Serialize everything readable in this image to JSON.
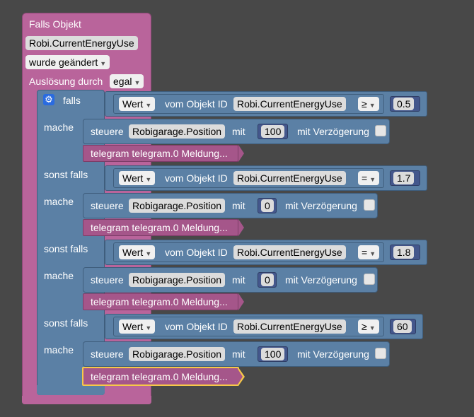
{
  "trigger": {
    "title": "Falls Objekt",
    "object_id": "Robi.CurrentEnergyUse",
    "condition": "wurde geändert",
    "trigger_label": "Auslösung durch",
    "trigger_value": "egal"
  },
  "labels": {
    "if": "falls",
    "do": "mache",
    "else_if": "sonst falls",
    "value_dd": "Wert",
    "from_object": "vom Objekt ID",
    "control": "steuere",
    "with": "mit",
    "with_delay": "mit Verzögerung",
    "telegram": "telegram telegram.0 Meldung..."
  },
  "branches": [
    {
      "object_id": "Robi.CurrentEnergyUse",
      "operator": "≥",
      "compare_value": "0.5",
      "target": "Robigarage.Position",
      "set_value": "100"
    },
    {
      "object_id": "Robi.CurrentEnergyUse",
      "operator": "=",
      "compare_value": "1.7",
      "target": "Robigarage.Position",
      "set_value": "0"
    },
    {
      "object_id": "Robi.CurrentEnergyUse",
      "operator": "=",
      "compare_value": "1.8",
      "target": "Robigarage.Position",
      "set_value": "0"
    },
    {
      "object_id": "Robi.CurrentEnergyUse",
      "operator": "≥",
      "compare_value": "60",
      "target": "Robigarage.Position",
      "set_value": "100"
    }
  ],
  "icons": {
    "gear": "gear-icon",
    "dropdown": "dropdown-arrow-icon"
  },
  "colors": {
    "background": "#484848",
    "trigger": "#b9649b",
    "logic": "#5b80a5",
    "telegram": "#a5568a",
    "selection": "#f7c948"
  }
}
